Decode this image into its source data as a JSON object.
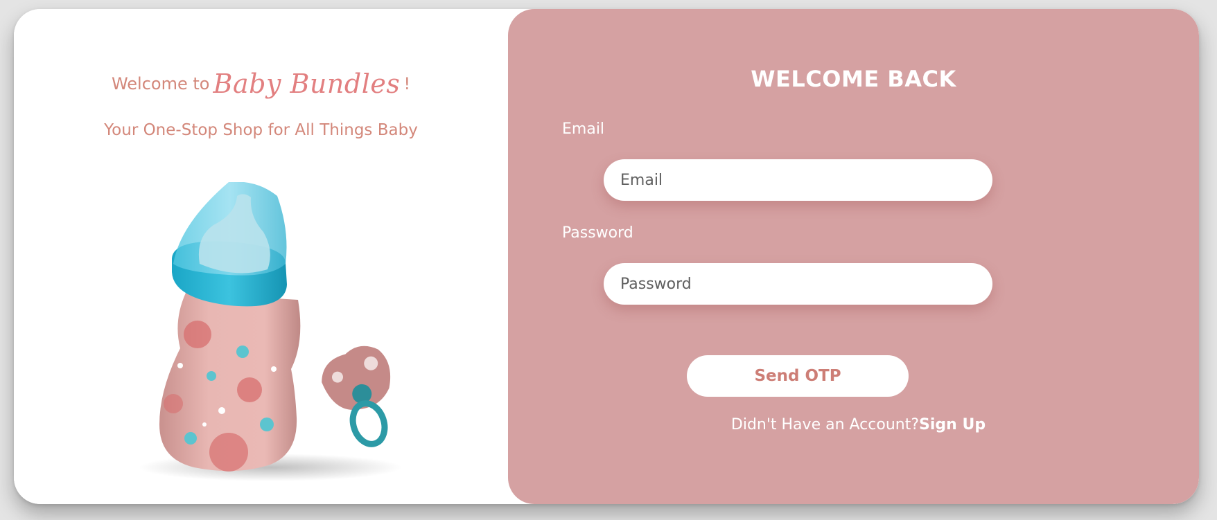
{
  "brand_panel": {
    "welcome_prefix": "Welcome to",
    "brand_name": "Baby Bundles",
    "welcome_suffix": "!",
    "tagline": "Your One-Stop Shop for All Things Baby",
    "illustration": "baby-bottle-and-pacifier-image"
  },
  "login_form": {
    "title": "WELCOME BACK",
    "email_label": "Email",
    "email_placeholder": "Email",
    "email_value": "",
    "password_label": "Password",
    "password_placeholder": "Password",
    "password_value": "",
    "submit_label": "Send OTP",
    "signup_prompt": "Didn't Have an Account?",
    "signup_link": "Sign Up"
  },
  "colors": {
    "panel_pink": "#d5a1a2",
    "brand_text": "#d3877a",
    "button_text": "#cd7e76",
    "white": "#ffffff"
  }
}
